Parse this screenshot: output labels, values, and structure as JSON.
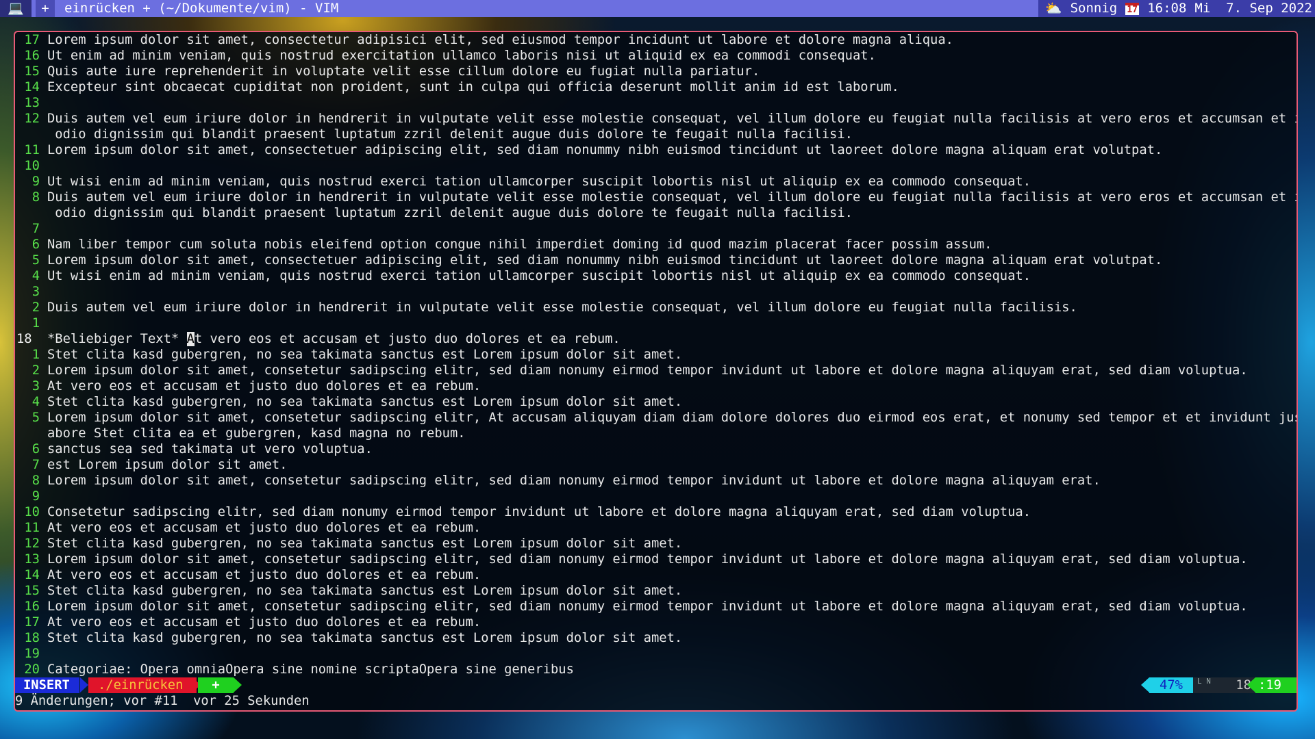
{
  "panel": {
    "terminal_icon": "💻",
    "new_tab_label": "+",
    "window_title": "einrücken + (~/Dokumente/vim) - VIM",
    "weather_icon": "⛅",
    "weather_text": "Sonnig",
    "calendar_icon": "17",
    "time": "16:08",
    "date": "Mi  7. Sep 2022"
  },
  "buffer": {
    "lines": [
      {
        "nr": "17",
        "text": "Lorem ipsum dolor sit amet, consectetur adipisici elit, sed eiusmod tempor incidunt ut labore et dolore magna aliqua."
      },
      {
        "nr": "16",
        "text": "Ut enim ad minim veniam, quis nostrud exercitation ullamco laboris nisi ut aliquid ex ea commodi consequat."
      },
      {
        "nr": "15",
        "text": "Quis aute iure reprehenderit in voluptate velit esse cillum dolore eu fugiat nulla pariatur."
      },
      {
        "nr": "14",
        "text": "Excepteur sint obcaecat cupiditat non proident, sunt in culpa qui officia deserunt mollit anim id est laborum."
      },
      {
        "nr": "13",
        "text": ""
      },
      {
        "nr": "12",
        "text": "Duis autem vel eum iriure dolor in hendrerit in vulputate velit esse molestie consequat, vel illum dolore eu feugiat nulla facilisis at vero eros et accumsan et iusto"
      },
      {
        "nr": "",
        "text": " odio dignissim qui blandit praesent luptatum zzril delenit augue duis dolore te feugait nulla facilisi."
      },
      {
        "nr": "11",
        "text": "Lorem ipsum dolor sit amet, consectetuer adipiscing elit, sed diam nonummy nibh euismod tincidunt ut laoreet dolore magna aliquam erat volutpat."
      },
      {
        "nr": "10",
        "text": ""
      },
      {
        "nr": "9",
        "text": "Ut wisi enim ad minim veniam, quis nostrud exerci tation ullamcorper suscipit lobortis nisl ut aliquip ex ea commodo consequat."
      },
      {
        "nr": "8",
        "text": "Duis autem vel eum iriure dolor in hendrerit in vulputate velit esse molestie consequat, vel illum dolore eu feugiat nulla facilisis at vero eros et accumsan et iusto"
      },
      {
        "nr": "",
        "text": " odio dignissim qui blandit praesent luptatum zzril delenit augue duis dolore te feugait nulla facilisi."
      },
      {
        "nr": "7",
        "text": ""
      },
      {
        "nr": "6",
        "text": "Nam liber tempor cum soluta nobis eleifend option congue nihil imperdiet doming id quod mazim placerat facer possim assum."
      },
      {
        "nr": "5",
        "text": "Lorem ipsum dolor sit amet, consectetuer adipiscing elit, sed diam nonummy nibh euismod tincidunt ut laoreet dolore magna aliquam erat volutpat."
      },
      {
        "nr": "4",
        "text": "Ut wisi enim ad minim veniam, quis nostrud exerci tation ullamcorper suscipit lobortis nisl ut aliquip ex ea commodo consequat."
      },
      {
        "nr": "3",
        "text": ""
      },
      {
        "nr": "2",
        "text": "Duis autem vel eum iriure dolor in hendrerit in vulputate velit esse molestie consequat, vel illum dolore eu feugiat nulla facilisis."
      },
      {
        "nr": "1",
        "text": ""
      },
      {
        "nr": "18",
        "current": true,
        "before": "*Beliebiger Text* ",
        "cursor": "A",
        "after": "t vero eos et accusam et justo duo dolores et ea rebum."
      },
      {
        "nr": "1",
        "text": "Stet clita kasd gubergren, no sea takimata sanctus est Lorem ipsum dolor sit amet."
      },
      {
        "nr": "2",
        "text": "Lorem ipsum dolor sit amet, consetetur sadipscing elitr, sed diam nonumy eirmod tempor invidunt ut labore et dolore magna aliquyam erat, sed diam voluptua."
      },
      {
        "nr": "3",
        "text": "At vero eos et accusam et justo duo dolores et ea rebum."
      },
      {
        "nr": "4",
        "text": "Stet clita kasd gubergren, no sea takimata sanctus est Lorem ipsum dolor sit amet."
      },
      {
        "nr": "5",
        "text": "Lorem ipsum dolor sit amet, consetetur sadipscing elitr, At accusam aliquyam diam diam dolore dolores duo eirmod eos erat, et nonumy sed tempor et et invidunt justo l"
      },
      {
        "nr": "",
        "text": "abore Stet clita ea et gubergren, kasd magna no rebum."
      },
      {
        "nr": "6",
        "text": "sanctus sea sed takimata ut vero voluptua."
      },
      {
        "nr": "7",
        "text": "est Lorem ipsum dolor sit amet."
      },
      {
        "nr": "8",
        "text": "Lorem ipsum dolor sit amet, consetetur sadipscing elitr, sed diam nonumy eirmod tempor invidunt ut labore et dolore magna aliquyam erat."
      },
      {
        "nr": "9",
        "text": ""
      },
      {
        "nr": "10",
        "text": "Consetetur sadipscing elitr, sed diam nonumy eirmod tempor invidunt ut labore et dolore magna aliquyam erat, sed diam voluptua."
      },
      {
        "nr": "11",
        "text": "At vero eos et accusam et justo duo dolores et ea rebum."
      },
      {
        "nr": "12",
        "text": "Stet clita kasd gubergren, no sea takimata sanctus est Lorem ipsum dolor sit amet."
      },
      {
        "nr": "13",
        "text": "Lorem ipsum dolor sit amet, consetetur sadipscing elitr, sed diam nonumy eirmod tempor invidunt ut labore et dolore magna aliquyam erat, sed diam voluptua."
      },
      {
        "nr": "14",
        "text": "At vero eos et accusam et justo duo dolores et ea rebum."
      },
      {
        "nr": "15",
        "text": "Stet clita kasd gubergren, no sea takimata sanctus est Lorem ipsum dolor sit amet."
      },
      {
        "nr": "16",
        "text": "Lorem ipsum dolor sit amet, consetetur sadipscing elitr, sed diam nonumy eirmod tempor invidunt ut labore et dolore magna aliquyam erat, sed diam voluptua."
      },
      {
        "nr": "17",
        "text": "At vero eos et accusam et justo duo dolores et ea rebum."
      },
      {
        "nr": "18",
        "text": "Stet clita kasd gubergren, no sea takimata sanctus est Lorem ipsum dolor sit amet."
      },
      {
        "nr": "19",
        "text": ""
      },
      {
        "nr": "20",
        "text": "Categoriae: Opera omniaOpera sine nomine scriptaOpera sine generibus"
      }
    ]
  },
  "statusline": {
    "mode": "INSERT",
    "file": "./einrücken",
    "modified": "+",
    "percent": "47%",
    "ln_symbol": "L N",
    "line": "18",
    "column": ":19"
  },
  "cmdline": {
    "message": "9 Änderungen; vor #11  vor 25 Sekunden"
  },
  "colors": {
    "panel": "#6c6fe0",
    "border": "#e85a76",
    "line_number": "#58e04a",
    "mode_insert": "#1b2bd8",
    "file": "#e0142a",
    "modified": "#1fd01f",
    "percent": "#1fd0e8"
  }
}
